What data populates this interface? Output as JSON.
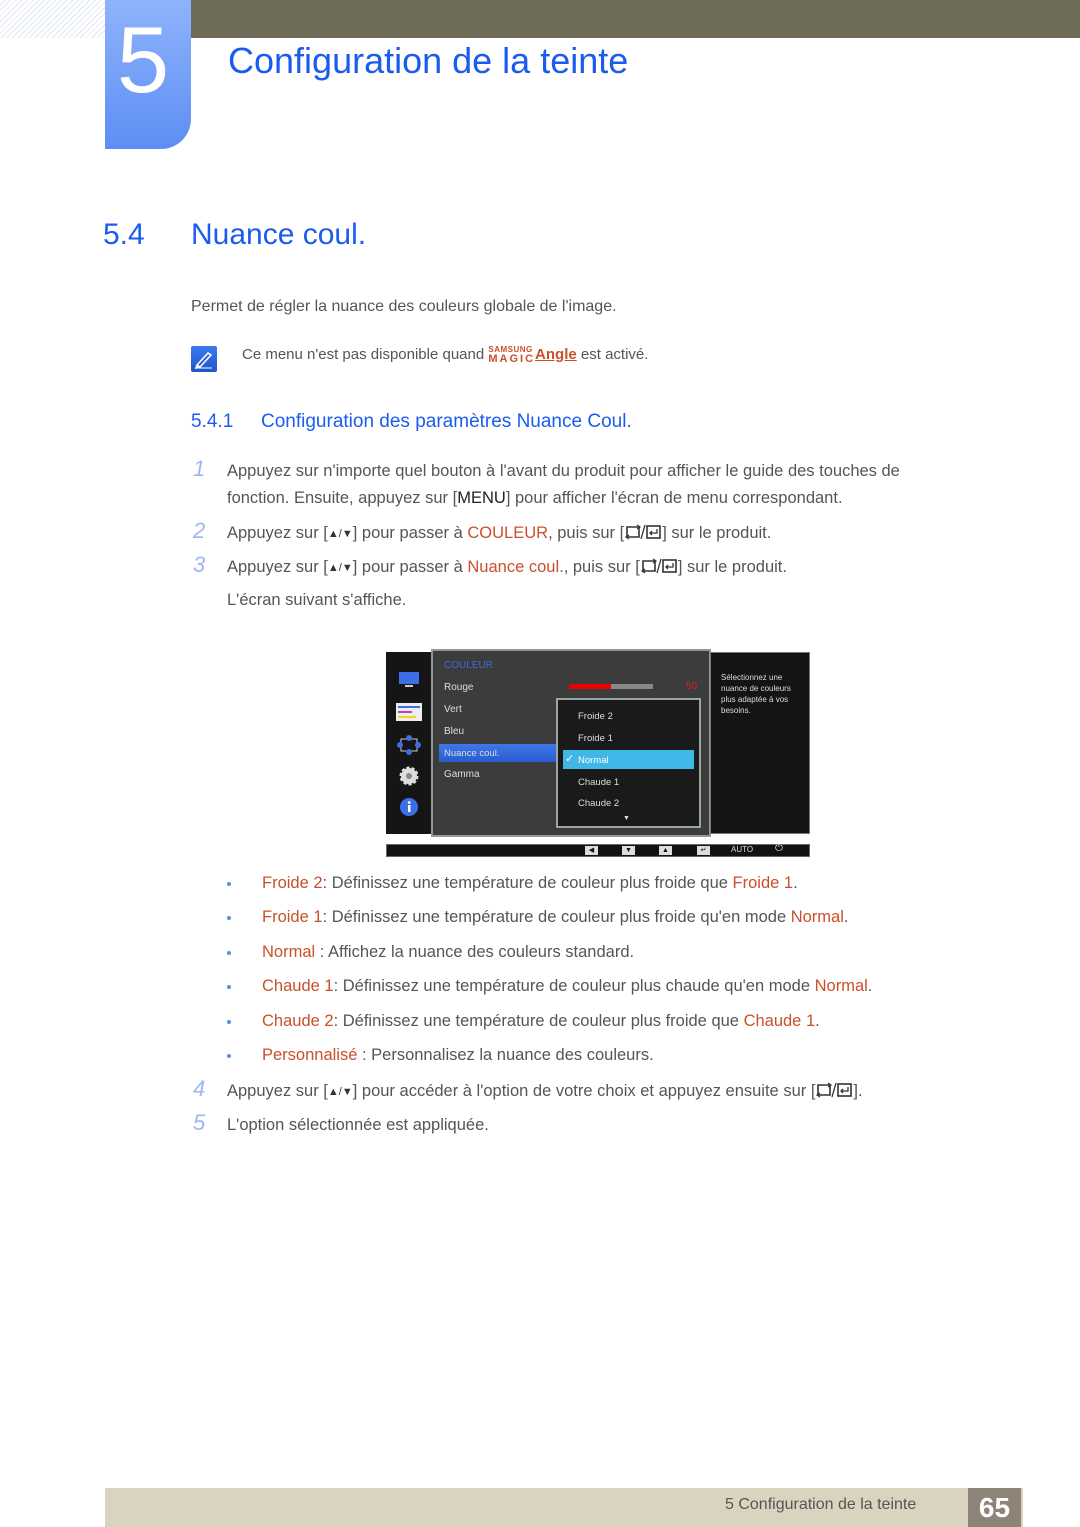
{
  "chapter": {
    "number": "5",
    "title": "Configuration de la teinte"
  },
  "section": {
    "number": "5.4",
    "title": "Nuance coul."
  },
  "intro": "Permet de régler la nuance des couleurs globale de l'image.",
  "note": {
    "before": "Ce menu n'est pas disponible quand ",
    "brand_top": "SAMSUNG",
    "brand_bottom": "MAGIC",
    "brand_link": "Angle",
    "after": " est activé."
  },
  "subsection": {
    "number": "5.4.1",
    "title": "Configuration des paramètres Nuance Coul."
  },
  "steps": [
    {
      "num": "1",
      "line1": "Appuyez sur n'importe quel bouton à l'avant du produit pour afficher le guide des touches de",
      "line2a": "fonction. Ensuite, appuyez sur [",
      "key": "MENU",
      "line2b": "] pour afficher l'écran de menu correspondant."
    },
    {
      "num": "2",
      "a": "Appuyez sur [",
      "updown": "▲/▼",
      "b": "] pour passer à ",
      "hl": "COULEUR",
      "c": ", puis sur [",
      "d": "] sur le produit."
    },
    {
      "num": "3",
      "a": "Appuyez sur [",
      "updown": "▲/▼",
      "b": "] pour passer à ",
      "hl": "Nuance coul.",
      "c": ", puis sur [",
      "d": "] sur le produit.",
      "line2": "L'écran suivant s'affiche."
    },
    {
      "num": "4",
      "a": "Appuyez sur [",
      "updown": "▲/▼",
      "b": "] pour accéder à l'option de votre choix et appuyez ensuite sur [",
      "d": "]."
    },
    {
      "num": "5",
      "a": "L'option sélectionnée est appliquée."
    }
  ],
  "osd": {
    "header": "COULEUR",
    "items": [
      "Rouge",
      "Vert",
      "Bleu",
      "Nuance coul.",
      "Gamma"
    ],
    "selected_item": "Nuance coul.",
    "rouge_value": "50",
    "rouge_fraction": 0.5,
    "dropdown": [
      "Froide 2",
      "Froide 1",
      "Normal",
      "Chaude 1",
      "Chaude 2"
    ],
    "dropdown_selected": "Normal",
    "help": "Sélectionnez une nuance de couleurs plus adaptée à vos besoins.",
    "footer": {
      "left": "◀",
      "down": "▼",
      "up": "▲",
      "enter": "↵",
      "auto": "AUTO",
      "power": "⏻"
    }
  },
  "bullets": [
    {
      "term": "Froide 2",
      "sep": ": ",
      "text": "Définissez une température de couleur plus froide que ",
      "ref": "Froide 1",
      "end": "."
    },
    {
      "term": "Froide 1",
      "sep": ": ",
      "text": "Définissez une température de couleur plus froide qu'en mode ",
      "ref": "Normal",
      "end": "."
    },
    {
      "term": "Normal",
      "sep": " : ",
      "text": "Affichez la nuance des couleurs standard.",
      "ref": "",
      "end": ""
    },
    {
      "term": "Chaude 1",
      "sep": ": ",
      "text": "Définissez une température de couleur plus chaude qu'en mode ",
      "ref": "Normal",
      "end": "."
    },
    {
      "term": "Chaude 2",
      "sep": ": ",
      "text": "Définissez une température de couleur plus froide que ",
      "ref": "Chaude 1",
      "end": "."
    },
    {
      "term": "Personnalisé",
      "sep": " : ",
      "text": "Personnalisez la nuance des couleurs.",
      "ref": "",
      "end": ""
    }
  ],
  "footer": {
    "text": "5 Configuration de la teinte",
    "page": "65"
  },
  "colors": {
    "accent_blue": "#1a5cf0",
    "highlight": "#c8502a",
    "topbar": "#6e6b58",
    "footer": "#d9d3bf",
    "page_badge": "#8d8377"
  }
}
